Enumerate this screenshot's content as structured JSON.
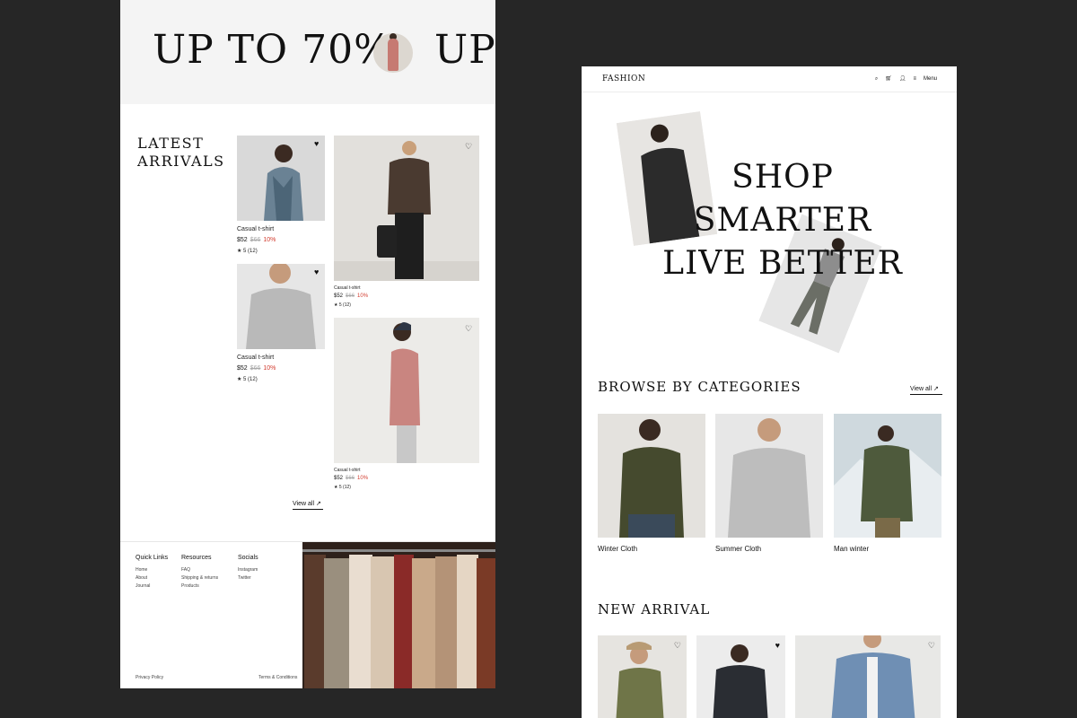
{
  "left": {
    "marquee": {
      "text1": "UP TO 70%",
      "text2": "UP"
    },
    "latest_title_line1": "LATEST",
    "latest_title_line2": "ARRIVALS",
    "products": [
      {
        "name": "Casual t-shirt",
        "price": "$52",
        "old_price": "$66",
        "discount": "10%",
        "rating": "★ 5 (12)",
        "heart": "♥"
      },
      {
        "name": "Casual t-shirt",
        "price": "$52",
        "old_price": "$66",
        "discount": "10%",
        "rating": "★ 5 (12)",
        "heart": "♡"
      },
      {
        "name": "Casual t-shirt",
        "price": "$52",
        "old_price": "$66",
        "discount": "10%",
        "rating": "★ 5 (12)",
        "heart": "♥"
      },
      {
        "name": "Casual t-shirt",
        "price": "$52",
        "old_price": "$66",
        "discount": "10%",
        "rating": "★ 5 (12)",
        "heart": "♡"
      }
    ],
    "view_all": "View all ↗",
    "footer": {
      "quick_links_title": "Quick Links",
      "quick_links": [
        "Home",
        "About",
        "Journal"
      ],
      "resources_title": "Resources",
      "resources": [
        "FAQ",
        "Shipping & returns",
        "Products"
      ],
      "socials_title": "Socials",
      "socials": [
        "Instagram",
        "Twitter"
      ],
      "privacy": "Privacy Policy",
      "terms": "Terms & Conditions"
    }
  },
  "right": {
    "logo": "FASHION",
    "menu_label": "Menu",
    "hero_line1": "SHOP",
    "hero_line2": "SMARTER",
    "hero_line3": "LIVE BETTER",
    "browse_title": "BROWSE BY CATEGORIES",
    "view_all": "View all ↗",
    "categories": [
      "Winter Cloth",
      "Summer Cloth",
      "Man winter"
    ],
    "new_arrival_title": "NEW ARRIVAL"
  },
  "colors": {
    "background": "#262626",
    "accent_red": "#d23b2e",
    "panel": "#ffffff"
  }
}
